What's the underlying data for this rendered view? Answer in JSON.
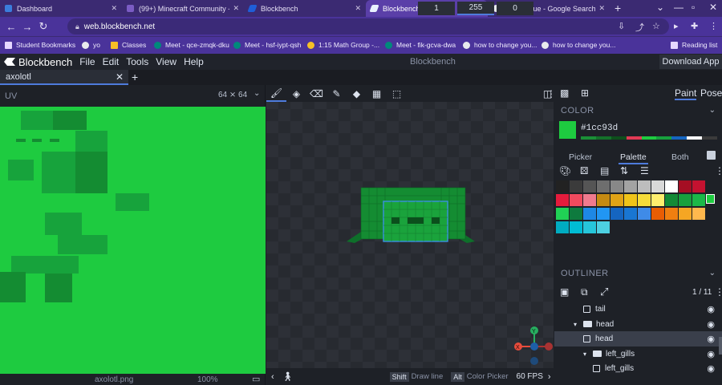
{
  "browser": {
    "tabs": [
      {
        "title": "Dashboard",
        "color": "#3b7ddd"
      },
      {
        "title": "(99+) Minecraft Community - ...",
        "color": "#7b5cc4"
      },
      {
        "title": "Blockbench",
        "color": "#1f5ed8"
      },
      {
        "title": "Blockbench",
        "color": "#e9f1ff"
      },
      {
        "title": "axolotl blue - Google Search",
        "color": "#e8eaed"
      }
    ],
    "new_tab": "+",
    "url": "web.blockbench.net",
    "bookmarks": [
      "Student Bookmarks",
      "yo",
      "Classes",
      "Meet - qce-zmqk-dku",
      "Meet - hsf-iypt-qsh",
      "1:15 Math Group -...",
      "Meet - fik-gcva-dwa",
      "how to change you...",
      "how to change you..."
    ],
    "reading_list": "Reading list"
  },
  "app": {
    "name": "Blockbench",
    "menus": [
      "File",
      "Edit",
      "Tools",
      "View",
      "Help"
    ],
    "center_title": "Blockbench",
    "download": "Download App",
    "doc_tab": "axolotl",
    "add_tab": "+"
  },
  "uv": {
    "title": "UV",
    "size": "64 ⨯ 64",
    "texture_name": "axolotl.png",
    "zoom": "100%",
    "base_color": "#1ecb40",
    "shade": "#148c32",
    "light": "#17a33c"
  },
  "toolbar": {
    "size_value": "1",
    "opacity_value": "255",
    "softness_value": "0"
  },
  "status": {
    "key1": "Shift",
    "hint1": "Draw line",
    "key2": "Alt",
    "hint2": "Color Picker",
    "fps": "60 FPS"
  },
  "gizmo": {
    "y": "Y",
    "x": "X"
  },
  "right_panel": {
    "mode_paint": "Paint",
    "mode_pose": "Pose",
    "color_title": "COLOR",
    "hex": "#1cc93d",
    "picker_tabs": [
      "Picker",
      "Palette",
      "Both"
    ],
    "outliner_title": "OUTLINER",
    "outliner_count": "1 / 11",
    "outliner": [
      {
        "label": "tail",
        "type": "cube",
        "indent": 2
      },
      {
        "label": "head",
        "type": "group",
        "indent": 1
      },
      {
        "label": "head",
        "type": "cube",
        "indent": 2,
        "selected": true
      },
      {
        "label": "left_gills",
        "type": "group",
        "indent": 2
      },
      {
        "label": "left_gills",
        "type": "cube",
        "indent": 3
      }
    ]
  },
  "palette": [
    "#222222",
    "#3b3b3b",
    "#555555",
    "#6e6e6e",
    "#888888",
    "#a3a3a3",
    "#bdbdbd",
    "#d9d9d9",
    "#ffffff",
    "#a50e23",
    "#c41230",
    "#e41b3c",
    "#f04a5e",
    "#f07a8e",
    "#c58a12",
    "#e0a316",
    "#f0c419",
    "#f6dc3a",
    "#ffef6e",
    "#138a36",
    "#17a03d",
    "#1bb848",
    "#20d155",
    "#0e7a3e",
    "#1e88e5",
    "#2196f3",
    "#1565c0",
    "#1976d2",
    "#3f8be8",
    "#e85d04",
    "#f07f10",
    "#f5a623",
    "#ffb84d",
    "#00acc1",
    "#00bcd4",
    "#26c6da",
    "#4dd0e1"
  ]
}
